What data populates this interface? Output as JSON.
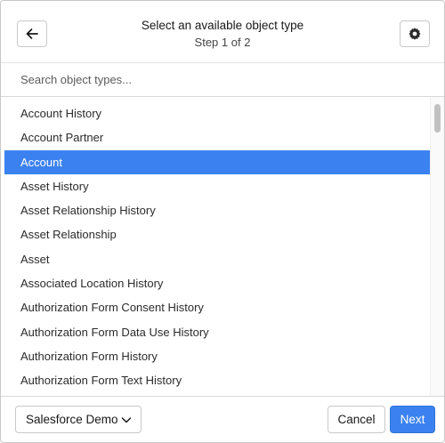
{
  "header": {
    "title": "Select an available object type",
    "step": "Step 1 of 2",
    "back_icon": "arrow-left-icon",
    "settings_icon": "gear-icon"
  },
  "search": {
    "placeholder": "Search object types...",
    "value": ""
  },
  "list": {
    "selected_index": 2,
    "items": [
      "Account History",
      "Account Partner",
      "Account",
      "Asset History",
      "Asset Relationship History",
      "Asset Relationship",
      "Asset",
      "Associated Location History",
      "Authorization Form Consent History",
      "Authorization Form Data Use History",
      "Authorization Form History",
      "Authorization Form Text History"
    ]
  },
  "footer": {
    "org_select_value": "Salesforce Demo",
    "cancel_label": "Cancel",
    "next_label": "Next"
  },
  "colors": {
    "accent": "#3b82f0",
    "border": "#c9c9c9"
  }
}
